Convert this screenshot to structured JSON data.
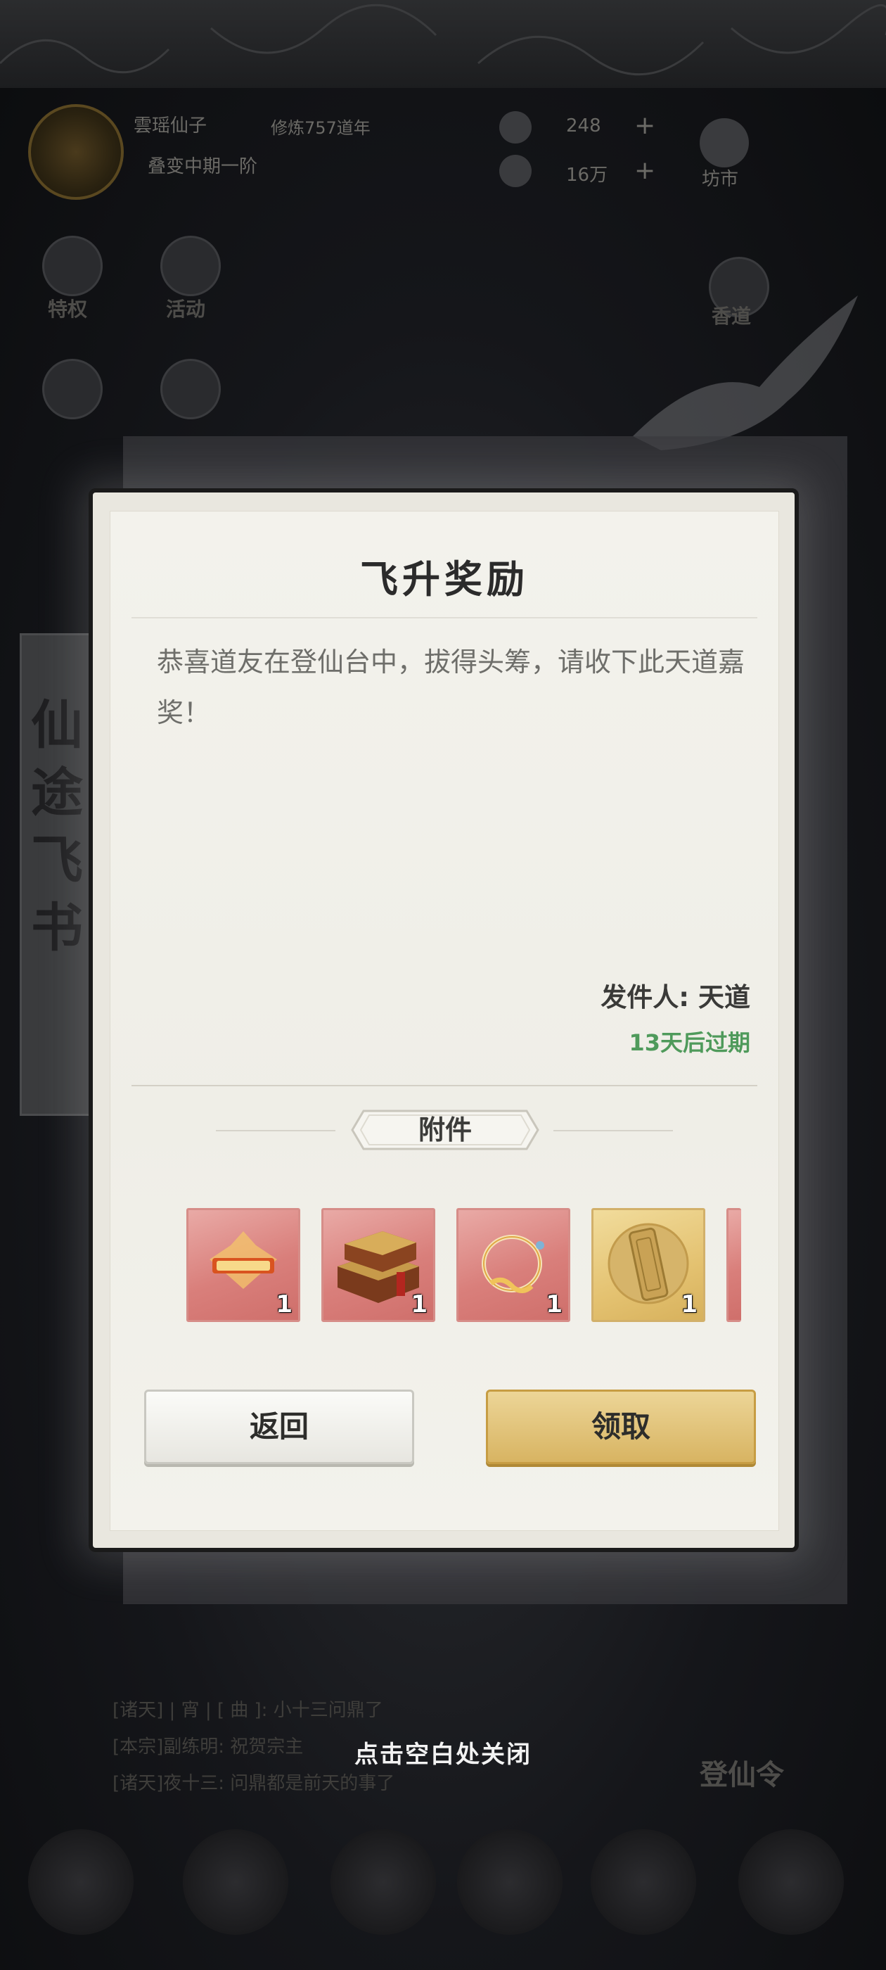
{
  "background": {
    "player_name": "雲瑶仙子",
    "player_subtitle": "修炼757道年",
    "player_realm": "叠变中期一阶",
    "currency_1": "248",
    "currency_2": "16万",
    "market_label": "坊市",
    "menu_privilege": "特权",
    "menu_activity": "活动",
    "menu_right": "香道",
    "side_scroll_text": "仙途飞书",
    "chat_lines": [
      "[诸天] | 宵 | [ 曲 ]: 小十三问鼎了",
      "[本宗]副练明: 祝贺宗主",
      "[诸天]夜十三: 问鼎都是前天的事了"
    ],
    "ascend_label": "登仙令"
  },
  "dialog": {
    "title": "飞升奖励",
    "message": "恭喜道友在登仙台中，拔得头筹，请收下此天道嘉奖！",
    "sender": "发件人: 天道",
    "expiry": "13天后过期",
    "attachment_label": "附件",
    "items": [
      {
        "icon": "title-badge-icon",
        "qty": "1",
        "rarity": "red"
      },
      {
        "icon": "treasure-boxes-icon",
        "qty": "1",
        "rarity": "red"
      },
      {
        "icon": "jade-ring-icon",
        "qty": "1",
        "rarity": "red"
      },
      {
        "icon": "token-plaque-icon",
        "qty": "1",
        "rarity": "gold"
      }
    ],
    "back_button": "返回",
    "claim_button": "领取"
  },
  "close_hint": "点击空白处关闭",
  "colors": {
    "expiry_green": "#4f9a5b",
    "red_rarity": "#d97f7b",
    "gold_rarity": "#e4c271",
    "claim_gold": "#d8b462"
  }
}
